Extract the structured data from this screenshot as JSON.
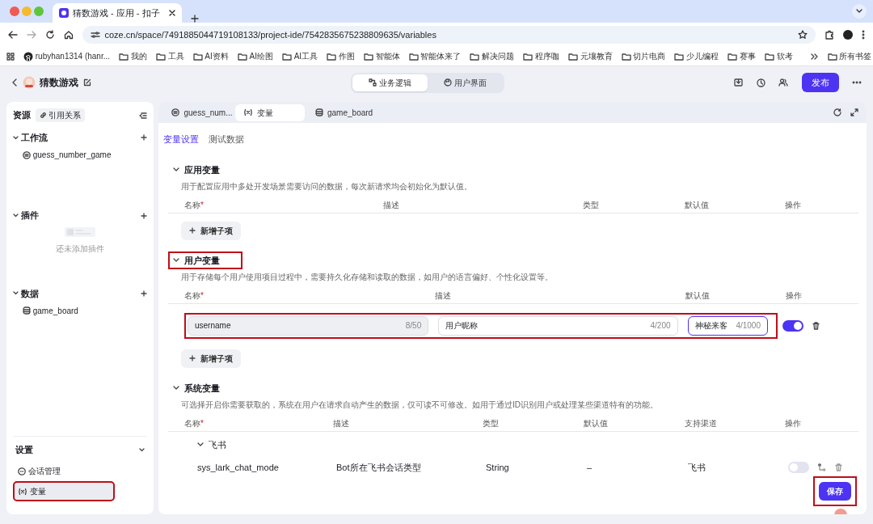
{
  "browser": {
    "tab_title": "猜数游戏 - 应用 - 扣子",
    "url": "coze.cn/space/7491885044719108133/project-ide/7542835675238809635/variables",
    "bookmarks": [
      {
        "label": "rubyhan1314 (hanr...",
        "kind": "github"
      },
      {
        "label": "我的",
        "kind": "folder"
      },
      {
        "label": "工具",
        "kind": "folder"
      },
      {
        "label": "AI资料",
        "kind": "folder"
      },
      {
        "label": "AI绘图",
        "kind": "folder"
      },
      {
        "label": "AI工具",
        "kind": "folder"
      },
      {
        "label": "作图",
        "kind": "folder"
      },
      {
        "label": "智能体",
        "kind": "folder"
      },
      {
        "label": "智能体来了",
        "kind": "folder"
      },
      {
        "label": "解决问题",
        "kind": "folder"
      },
      {
        "label": "程序咖",
        "kind": "folder"
      },
      {
        "label": "元壤教育",
        "kind": "folder"
      },
      {
        "label": "切片电商",
        "kind": "folder"
      },
      {
        "label": "少儿编程",
        "kind": "folder"
      },
      {
        "label": "赛事",
        "kind": "folder"
      },
      {
        "label": "软考",
        "kind": "folder"
      }
    ],
    "all_bookmarks": "所有书签"
  },
  "app": {
    "title": "猜数游戏",
    "modes": [
      {
        "label": "业务逻辑",
        "selected": true
      },
      {
        "label": "用户界面",
        "selected": false
      }
    ],
    "publish": "发布"
  },
  "sidebar": {
    "title": "资源",
    "ref_chip": "引用关系",
    "sections": [
      {
        "title": "工作流",
        "items": [
          {
            "label": "guess_number_game",
            "kind": "workflow"
          }
        ]
      },
      {
        "title": "插件",
        "empty": "还未添加插件"
      },
      {
        "title": "数据",
        "items": [
          {
            "label": "game_board",
            "kind": "database"
          }
        ]
      }
    ],
    "settings": {
      "title": "设置",
      "items": [
        {
          "label": "会话管理",
          "kind": "chat",
          "selected": false,
          "highlighted": false
        },
        {
          "label": "变量",
          "kind": "variable",
          "selected": true,
          "highlighted": true
        }
      ]
    }
  },
  "editor_tabs": [
    {
      "label": "guess_num...",
      "kind": "workflow",
      "selected": false
    },
    {
      "label": "变量",
      "kind": "variable",
      "selected": true
    },
    {
      "label": "game_board",
      "kind": "database",
      "selected": false
    }
  ],
  "subtabs": [
    {
      "label": "变量设置",
      "selected": true
    },
    {
      "label": "测试数据",
      "selected": false
    }
  ],
  "sections": [
    {
      "kind": "app",
      "title": "应用变量",
      "highlighted": false,
      "description": "用于配置应用中多处开发场景需要访问的数据，每次新请求均会初始化为默认值。",
      "columns": [
        {
          "label": "名称",
          "required_mark": "*"
        },
        {
          "label": "描述"
        },
        {
          "label": "类型"
        },
        {
          "label": "默认值"
        },
        {
          "label": "操作"
        }
      ],
      "add_button": "新增子项"
    },
    {
      "kind": "user",
      "title": "用户变量",
      "highlighted": true,
      "description": "用于存储每个用户使用项目过程中，需要持久化存储和读取的数据，如用户的语言偏好、个性化设置等。",
      "columns": [
        {
          "label": "名称",
          "required_mark": "*"
        },
        {
          "label": "描述"
        },
        {
          "label": "默认值"
        },
        {
          "label": "操作"
        }
      ],
      "rows": [
        {
          "name": "username",
          "name_count": "8/50",
          "description": "用户昵称",
          "description_count": "4/200",
          "default": "神秘来客",
          "default_count": "4/1000",
          "on": true,
          "highlighted": true
        }
      ],
      "add_button": "新增子项"
    },
    {
      "kind": "system",
      "title": "系统变量",
      "highlighted": false,
      "description": "可选择开启你需要获取的，系统在用户在请求自动产生的数据，仅可读不可修改。如用于通过ID识别用户或处理某些渠道特有的功能。",
      "columns": [
        {
          "label": "名称",
          "required_mark": "*"
        },
        {
          "label": "描述"
        },
        {
          "label": "类型"
        },
        {
          "label": "默认值"
        },
        {
          "label": "支持渠道"
        },
        {
          "label": "操作"
        }
      ],
      "groups": [
        {
          "title": "飞书",
          "rows": [
            {
              "name": "sys_lark_chat_mode",
              "description": "Bot所在飞书会话类型",
              "type": "String",
              "default": "–",
              "channel": "飞书",
              "on": false
            }
          ]
        }
      ]
    }
  ],
  "save_button": {
    "label": "保存",
    "highlighted": true
  }
}
